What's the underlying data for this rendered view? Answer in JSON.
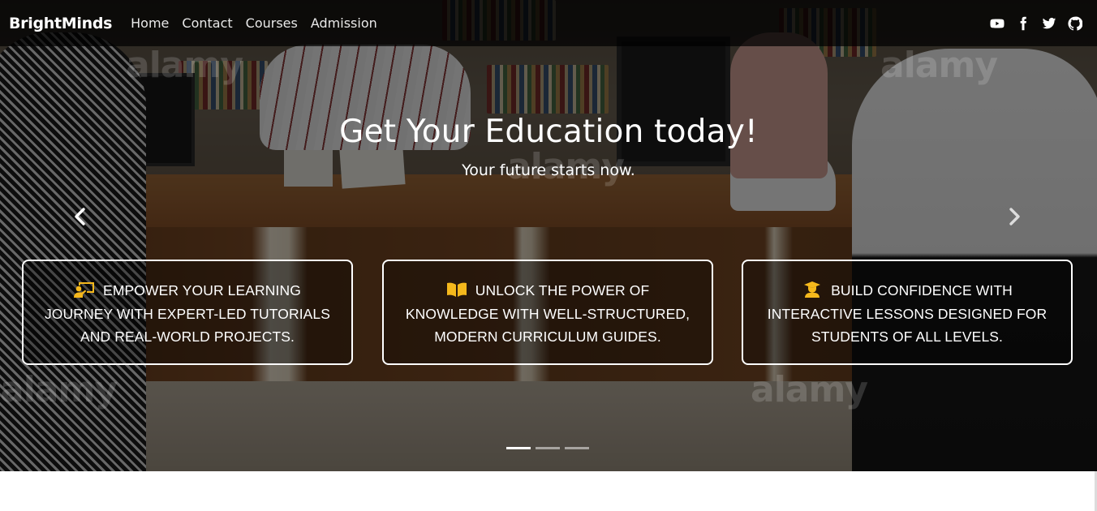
{
  "navbar": {
    "brand": "BrightMinds",
    "links": [
      "Home",
      "Contact",
      "Courses",
      "Admission"
    ],
    "social_icons": [
      "youtube-icon",
      "facebook-icon",
      "twitter-icon",
      "github-icon"
    ]
  },
  "hero": {
    "title": "Get Your Education today!",
    "subtitle": "Your future starts now.",
    "watermark_text": "alamy",
    "cards": [
      {
        "icon": "teacher-board-icon",
        "text": "Empower your learning journey with expert-led tutorials and real-world projects."
      },
      {
        "icon": "open-book-icon",
        "text": "Unlock the power of knowledge with well-structured, modern curriculum guides."
      },
      {
        "icon": "graduate-icon",
        "text": "Build confidence with interactive lessons designed for students of all levels."
      }
    ],
    "indicators": {
      "count": 3,
      "active_index": 0
    },
    "accent_color": "#f5b81c"
  }
}
